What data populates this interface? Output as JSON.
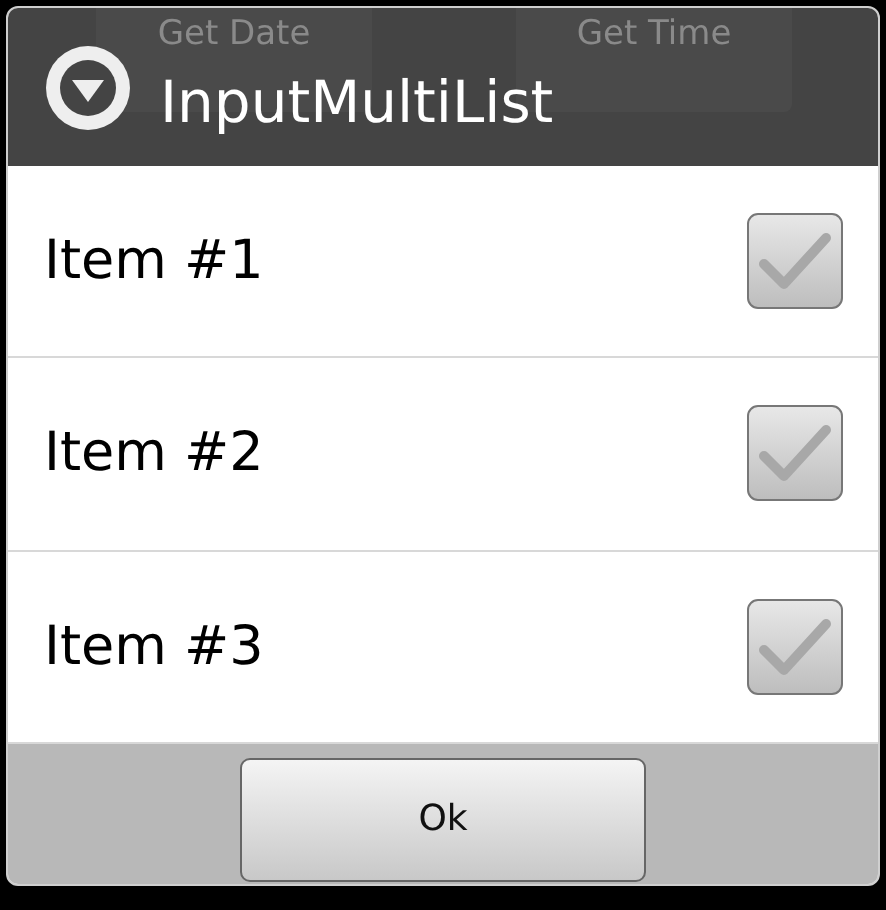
{
  "background_buttons": [
    "Get Date",
    "Get Time"
  ],
  "dialog": {
    "title": "InputMultiList",
    "items": [
      {
        "label": "Item #1",
        "checked": false
      },
      {
        "label": "Item #2",
        "checked": false
      },
      {
        "label": "Item #3",
        "checked": false
      }
    ],
    "buttons": [
      "Ok"
    ]
  }
}
